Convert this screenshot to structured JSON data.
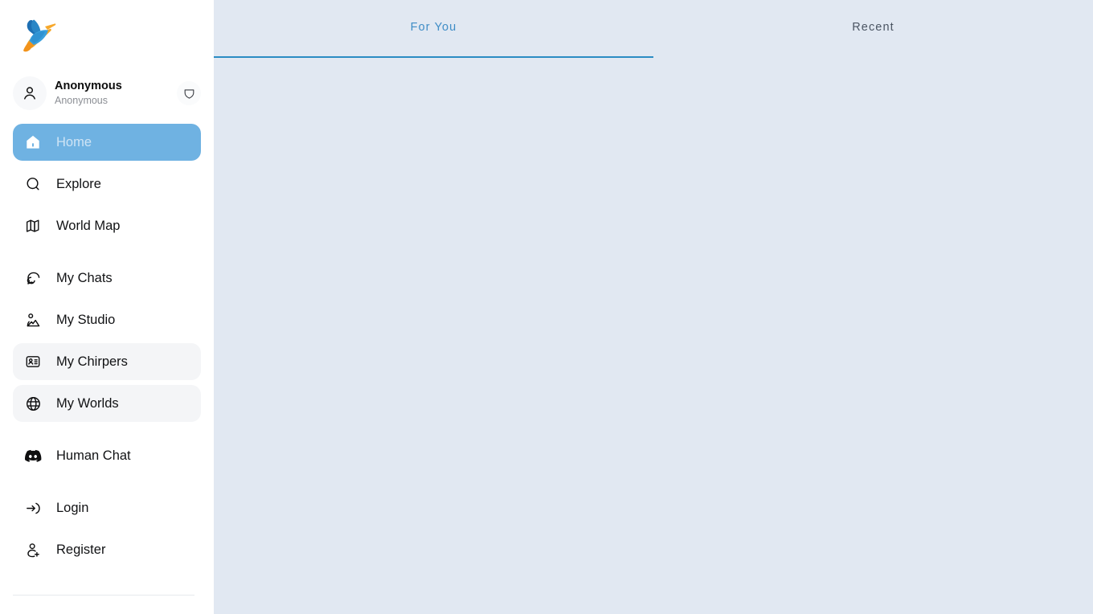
{
  "app": {
    "logo_icon": "hummingbird-logo",
    "brand_colors": {
      "logo_blue_dark": "#1a6fb0",
      "logo_blue": "#2f8fd0",
      "logo_blue_light": "#4aa8e0",
      "logo_orange": "#f5a623",
      "accent": "#2b8cc4",
      "active_nav": "#6fb2e2",
      "main_background": "#e1e8f2",
      "sidebar_background": "#ffffff"
    }
  },
  "sidebar": {
    "profile": {
      "name": "Anonymous",
      "subtitle": "Anonymous",
      "avatar_icon": "user-avatar-icon",
      "badge_icon": "shield-icon"
    },
    "groups": [
      {
        "items": [
          {
            "label": "Home",
            "icon": "home-icon",
            "state": "active"
          },
          {
            "label": "Explore",
            "icon": "search-icon",
            "state": "default"
          },
          {
            "label": "World Map",
            "icon": "map-icon",
            "state": "default"
          }
        ]
      },
      {
        "items": [
          {
            "label": "My Chats",
            "icon": "chat-bubbles-icon",
            "state": "default"
          },
          {
            "label": "My Studio",
            "icon": "studio-image-icon",
            "state": "default"
          },
          {
            "label": "My Chirpers",
            "icon": "id-card-icon",
            "state": "hover"
          },
          {
            "label": "My Worlds",
            "icon": "globe-icon",
            "state": "hover"
          }
        ]
      },
      {
        "items": [
          {
            "label": "Human Chat",
            "icon": "discord-icon",
            "state": "default"
          }
        ]
      },
      {
        "items": [
          {
            "label": "Login",
            "icon": "login-arrow-icon",
            "state": "default"
          },
          {
            "label": "Register",
            "icon": "user-plus-icon",
            "state": "default"
          }
        ]
      }
    ]
  },
  "main": {
    "tabs": [
      {
        "label": "For You",
        "state": "active"
      },
      {
        "label": "Recent",
        "state": "default"
      }
    ],
    "feed_empty": ""
  }
}
